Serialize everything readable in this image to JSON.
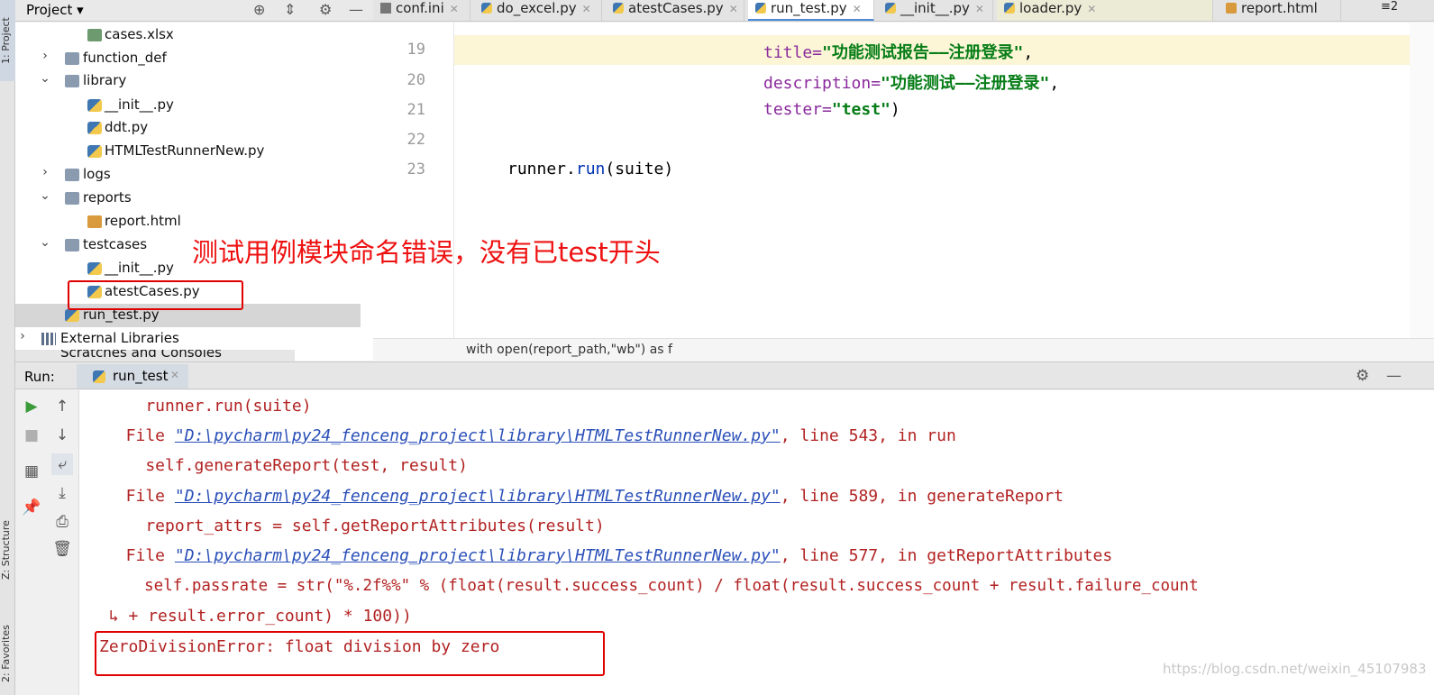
{
  "sidebar": {
    "project_tab": "1: Project",
    "structure_tab": "Z: Structure",
    "favorites_tab": "2: Favorites"
  },
  "project": {
    "title": "Project",
    "tree": [
      {
        "label": "cases.xlsx",
        "type": "xls",
        "expanded": null
      },
      {
        "label": "function_def",
        "type": "folder",
        "expanded": false
      },
      {
        "label": "library",
        "type": "folder",
        "expanded": true
      },
      {
        "label": "__init__.py",
        "type": "py",
        "expanded": null
      },
      {
        "label": "ddt.py",
        "type": "py",
        "expanded": null
      },
      {
        "label": "HTMLTestRunnerNew.py",
        "type": "py",
        "expanded": null
      },
      {
        "label": "logs",
        "type": "folder",
        "expanded": false
      },
      {
        "label": "reports",
        "type": "folder",
        "expanded": true
      },
      {
        "label": "report.html",
        "type": "html",
        "expanded": null
      },
      {
        "label": "testcases",
        "type": "folder",
        "expanded": true
      },
      {
        "label": "__init__.py",
        "type": "py",
        "expanded": null
      },
      {
        "label": "atestCases.py",
        "type": "py",
        "expanded": null
      },
      {
        "label": "run_test.py",
        "type": "py",
        "expanded": null,
        "selected": true
      },
      {
        "label": "External Libraries",
        "type": "lib",
        "expanded": false
      }
    ],
    "scratches_label": "Scratches and Consoles"
  },
  "annotation_text": "测试用例模块命名错误，没有已test开头",
  "tabs": [
    {
      "label": "conf.ini",
      "icon": "ini"
    },
    {
      "label": "do_excel.py",
      "icon": "py"
    },
    {
      "label": "atestCases.py",
      "icon": "py"
    },
    {
      "label": "run_test.py",
      "icon": "py",
      "active": true
    },
    {
      "label": "__init__.py",
      "icon": "py"
    },
    {
      "label": "loader.py",
      "icon": "py"
    },
    {
      "label": "report.html",
      "icon": "html"
    }
  ],
  "tabs_overflow": "2",
  "editor": {
    "line_numbers": [
      "19",
      "20",
      "21",
      "22",
      "23"
    ],
    "code": {
      "l19_param": "title=",
      "l19_str": "\"功能测试报告——注册登录\"",
      "l19_end": ",",
      "l20_param": "description=",
      "l20_str": "\"功能测试——注册登录\"",
      "l20_end": ",",
      "l21_param": "tester=",
      "l21_str": "\"test\"",
      "l21_end": ")",
      "l23_obj": "runner.",
      "l23_call": "run",
      "l23_rest": "(suite)"
    },
    "breadcrumb": "with open(report_path,\"wb\") as f"
  },
  "run": {
    "label": "Run:",
    "tab_label": "run_test",
    "console": {
      "l1": "    runner.run(suite)",
      "file_prefix": "  File ",
      "file_path": "\"D:\\pycharm\\py24_fenceng_project\\library\\HTMLTestRunnerNew.py\"",
      "l2_suffix": ", line 543, in run",
      "l3": "    self.generateReport(test, result)",
      "l4_suffix": ", line 589, in generateReport",
      "l5": "    report_attrs = self.getReportAttributes(result)",
      "l6_suffix": ", line 577, in getReportAttributes",
      "l7": "    self.passrate = str(\"%.2f%%\" % (float(result.success_count) / float(result.success_count + result.failure_count",
      "l8": " ↳ + result.error_count) * 100))",
      "error": "ZeroDivisionError: float division by zero"
    }
  },
  "watermark": "https://blog.csdn.net/weixin_45107983"
}
